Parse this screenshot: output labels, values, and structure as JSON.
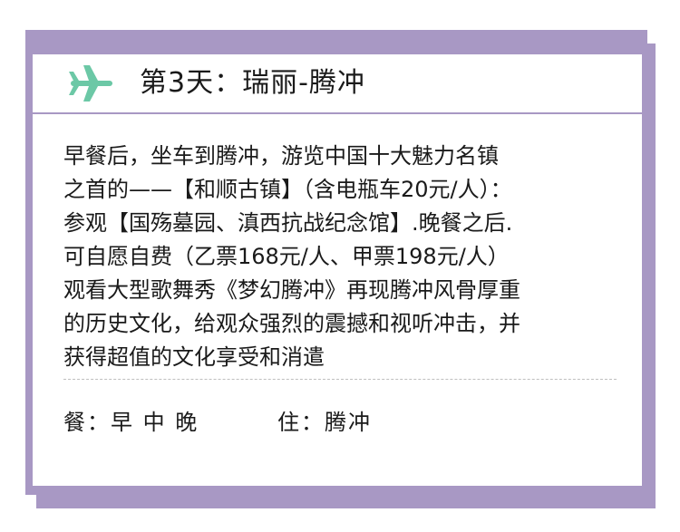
{
  "header": {
    "title": "第3天：瑞丽-腾冲",
    "icon": "plane-icon",
    "icon_color": "#6cc8a6"
  },
  "description": {
    "lines": [
      "早餐后，坐车到腾冲，游览中国十大魅力名镇",
      "之首的——【和顺古镇】（含电瓶车20元/人）：",
      "参观【国殇墓园、滇西抗战纪念馆】.晚餐之后.",
      "可自愿自费（乙票168元/人、甲票198元/人）",
      "观看大型歌舞秀《梦幻腾冲》再现腾冲风骨厚重",
      "的历史文化，给观众强烈的震撼和视听冲击，并",
      "获得超值的文化享受和消遣"
    ]
  },
  "footer": {
    "meals": "餐：早 中 晚",
    "stay": "住：腾冲"
  },
  "colors": {
    "frame": "#a898c4",
    "divider": "#bfbfbf"
  }
}
